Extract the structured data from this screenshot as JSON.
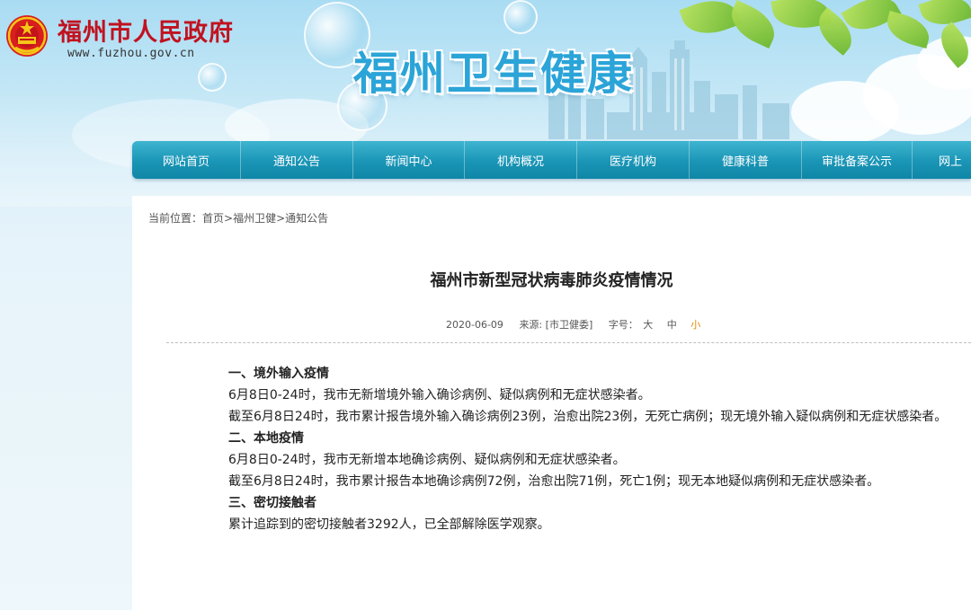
{
  "header": {
    "gov_name": "福州市人民政府",
    "gov_url": "www.fuzhou.gov.cn",
    "site_title": "福州卫生健康"
  },
  "nav": {
    "items": [
      "网站首页",
      "通知公告",
      "新闻中心",
      "机构概况",
      "医疗机构",
      "健康科普",
      "审批备案公示",
      "网上"
    ]
  },
  "breadcrumb": {
    "prefix": "当前位置：",
    "home": "首页",
    "sep1": ">",
    "section": "福州卫健",
    "sep2": ">",
    "current": "通知公告"
  },
  "article": {
    "title": "福州市新型冠状病毒肺炎疫情情况",
    "date": "2020-06-09",
    "source_label": "来源:",
    "source": "[市卫健委]",
    "fontsize_label": "字号：",
    "fontsize_large": "大",
    "fontsize_medium": "中",
    "fontsize_small": "小",
    "s1_heading": "一、境外输入疫情",
    "s1_p1": "6月8日0-24时，我市无新增境外输入确诊病例、疑似病例和无症状感染者。",
    "s1_p2": "截至6月8日24时，我市累计报告境外输入确诊病例23例，治愈出院23例，无死亡病例；现无境外输入疑似病例和无症状感染者。",
    "s2_heading": "二、本地疫情",
    "s2_p1": "6月8日0-24时，我市无新增本地确诊病例、疑似病例和无症状感染者。",
    "s2_p2": "截至6月8日24时，我市累计报告本地确诊病例72例，治愈出院71例，死亡1例；现无本地疑似病例和无症状感染者。",
    "s3_heading": "三、密切接触者",
    "s3_p1": "累计追踪到的密切接触者3292人，已全部解除医学观察。"
  },
  "colors": {
    "gov_red": "#c1121f",
    "title_blue": "#2ba4d8",
    "nav_teal": "#1a95b6",
    "small_font_orange": "#e08a00"
  },
  "icons": {
    "gov_emblem": "national-emblem-icon"
  }
}
